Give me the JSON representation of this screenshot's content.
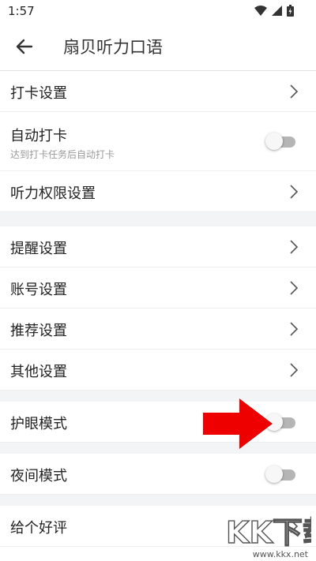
{
  "status_bar": {
    "time": "1:57",
    "icons": [
      "wifi-icon",
      "cellular-signal-icon",
      "battery-icon"
    ]
  },
  "app_bar": {
    "back_icon": "arrow-left-icon",
    "title": "扇贝听力口语"
  },
  "settings": [
    {
      "label": "打卡设置",
      "type": "link"
    },
    {
      "label": "自动打卡",
      "subtitle": "达到打卡任务后自动打卡",
      "type": "toggle",
      "on": false
    },
    {
      "label": "听力权限设置",
      "type": "link"
    },
    {
      "label": "提醒设置",
      "type": "link"
    },
    {
      "label": "账号设置",
      "type": "link"
    },
    {
      "label": "推荐设置",
      "type": "link"
    },
    {
      "label": "其他设置",
      "type": "link"
    },
    {
      "label": "护眼模式",
      "type": "toggle",
      "on": false
    },
    {
      "label": "夜间模式",
      "type": "toggle",
      "on": false
    },
    {
      "label": "给个好评",
      "type": "link"
    }
  ],
  "annotation": {
    "icon": "red-arrow-icon",
    "color": "#ee0000"
  },
  "watermark": {
    "logo": "KK下载",
    "url": "www.kkx.net"
  },
  "colors": {
    "divider_band": "#f2f4f5",
    "toggle_track_off": "#b5b5b5",
    "text_primary": "#222222",
    "text_secondary": "#999999"
  }
}
